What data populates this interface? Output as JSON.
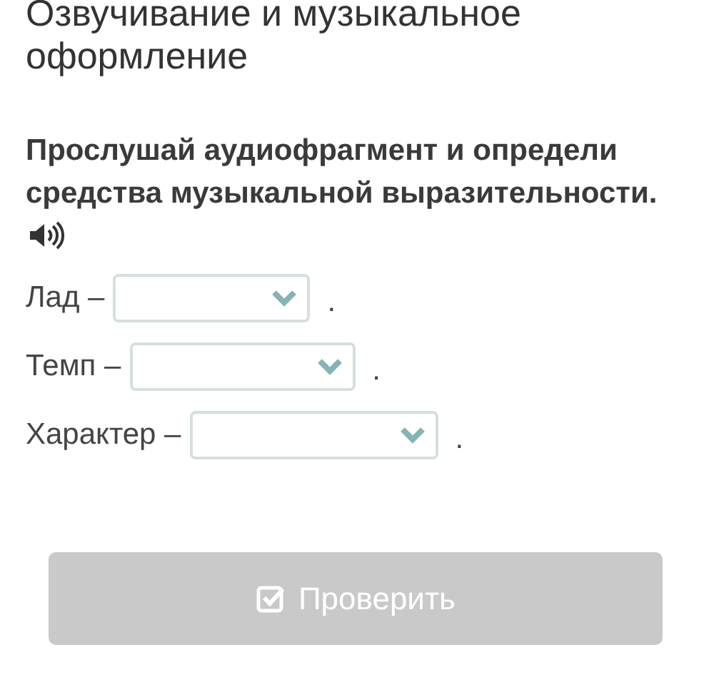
{
  "title": "Озвучивание и музыкальное оформление",
  "task": {
    "instruction": "Прослушай аудиофрагмент и определи средства музыкальной выразительности."
  },
  "items": [
    {
      "label": "Лад –",
      "after": "."
    },
    {
      "label": "Темп –",
      "after": "."
    },
    {
      "label": "Характер –",
      "after": "."
    }
  ],
  "check_button": {
    "label": "Проверить",
    "disabled": true
  }
}
